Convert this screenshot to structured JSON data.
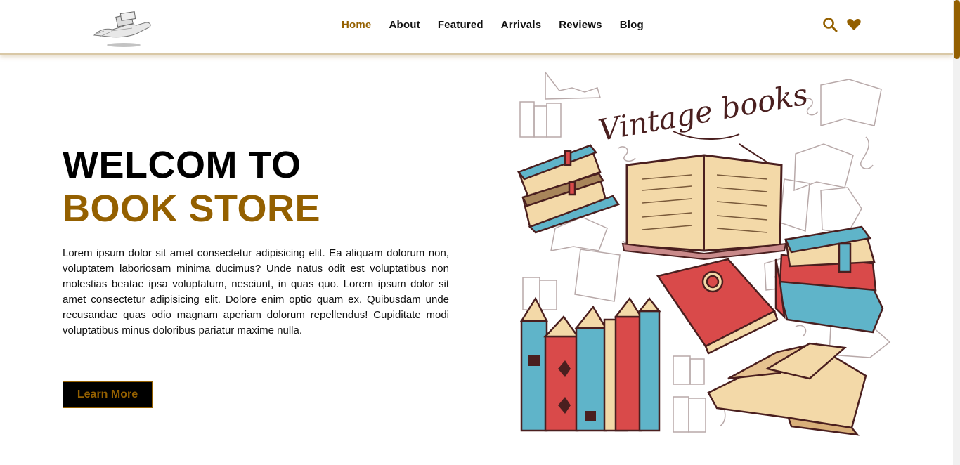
{
  "nav": {
    "items": [
      {
        "label": "Home",
        "active": true
      },
      {
        "label": "About",
        "active": false
      },
      {
        "label": "Featured",
        "active": false
      },
      {
        "label": "Arrivals",
        "active": false
      },
      {
        "label": "Reviews",
        "active": false
      },
      {
        "label": "Blog",
        "active": false
      }
    ],
    "icons": [
      "search-icon",
      "heart-icon"
    ]
  },
  "hero": {
    "title_line1": "WELCOM TO",
    "title_line2": "BOOK STORE",
    "description": "Lorem ipsum dolor sit amet consectetur adipisicing elit. Ea aliquam dolorum non, voluptatem laboriosam minima ducimus? Unde natus odit est voluptatibus non molestias beatae ipsa voluptatum, nesciunt, in quas quo. Lorem ipsum dolor sit amet consectetur adipisicing elit. Dolore enim optio quam ex. Quibusdam unde recusandae quas odio magnam aperiam dolorum repellendus! Cupiditate modi voluptatibus minus doloribus pariatur maxime nulla.",
    "button_label": "Learn More",
    "illustration_text": "Vintage books"
  },
  "colors": {
    "accent": "#946000",
    "text": "#111111",
    "book_red": "#d94a4a",
    "book_blue": "#5fb4c9",
    "book_cream": "#f3d9a8",
    "ink": "#4a1f1f"
  }
}
